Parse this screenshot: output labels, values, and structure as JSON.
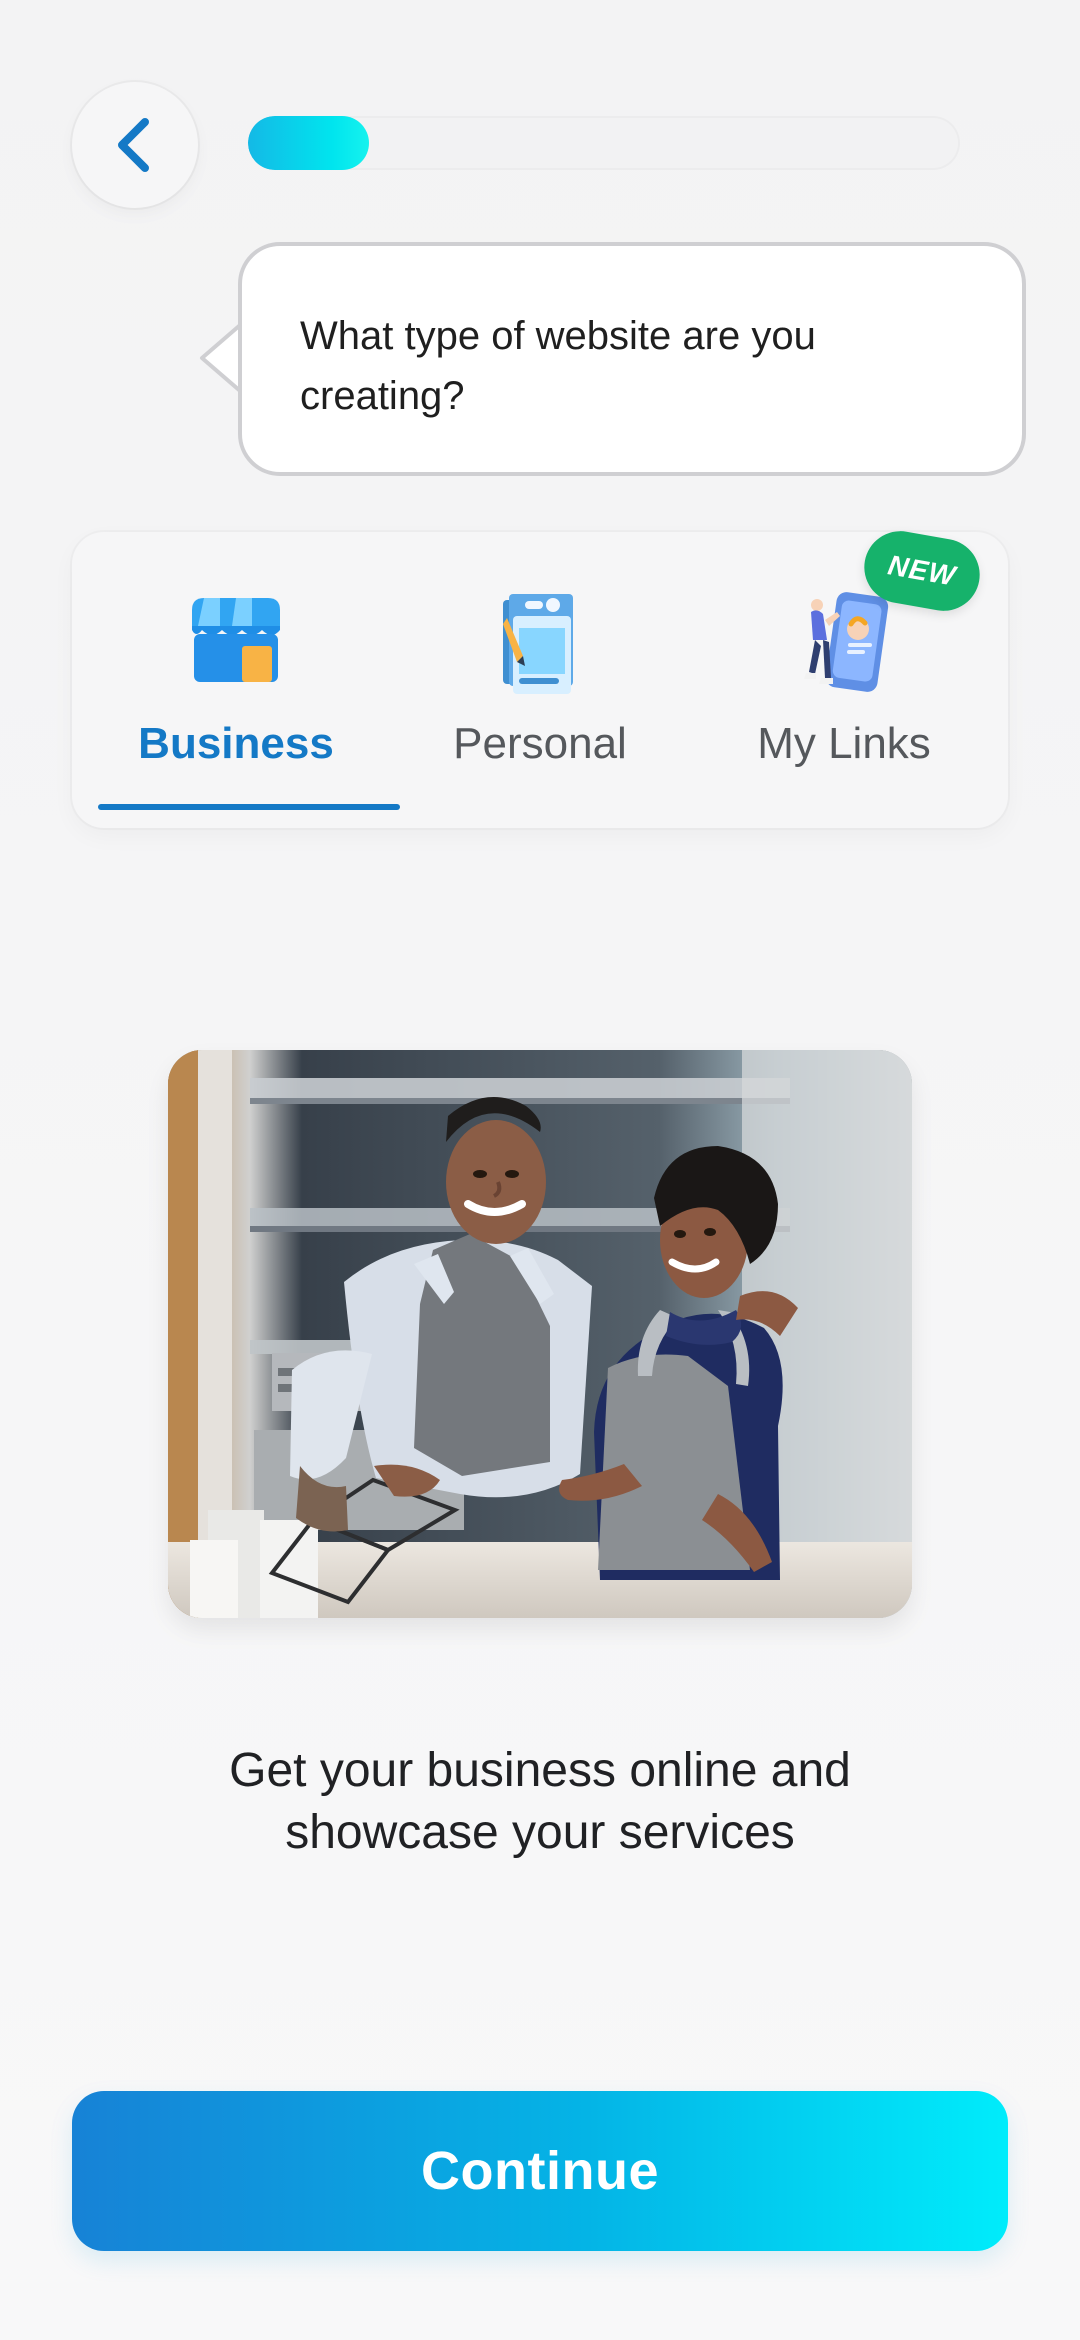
{
  "header": {
    "back_icon": "chevron-left-icon",
    "progress_fraction": 0.17
  },
  "prompt": {
    "text": "What type of website are you creating?"
  },
  "tabs": [
    {
      "label": "Business",
      "icon": "storefront-icon",
      "active": true
    },
    {
      "label": "Personal",
      "icon": "document-pencil-icon",
      "active": false
    },
    {
      "label": "My Links",
      "icon": "phone-profile-icon",
      "active": false,
      "badge": "NEW"
    }
  ],
  "selection": {
    "image_alt": "Two smiling people in aprons at a cafe counter",
    "description": "Get your business online and showcase your services"
  },
  "footer": {
    "continue_label": "Continue"
  },
  "colors": {
    "accent_blue": "#1479c6",
    "progress_cyan": "#00e5ee",
    "badge_green": "#16b26b"
  }
}
